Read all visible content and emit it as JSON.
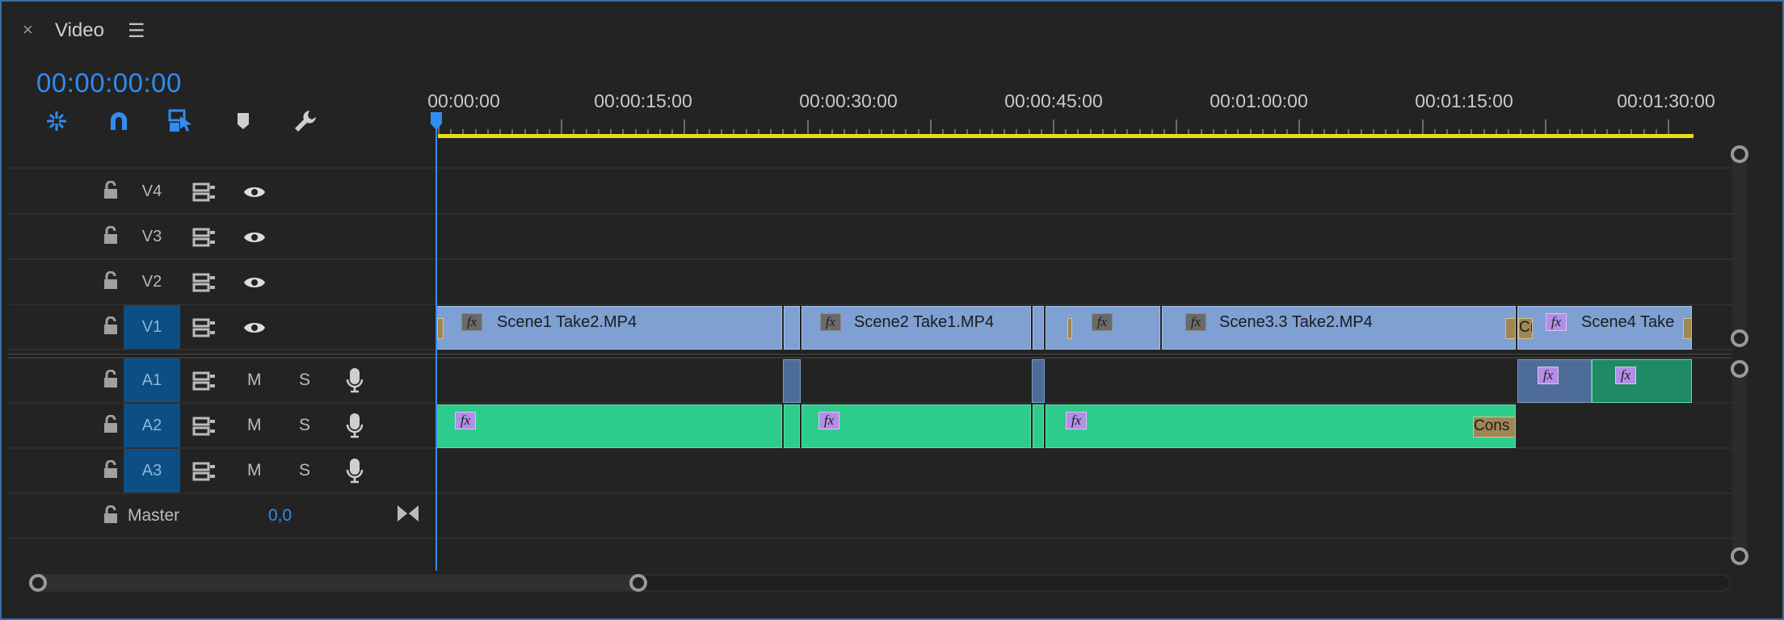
{
  "panel": {
    "close_glyph": "×",
    "title": "Video",
    "menu_glyph": "☰"
  },
  "timecode": "00:00:00:00",
  "toolbar": [
    "nest-sequence-icon",
    "snap-icon",
    "linked-selection-icon",
    "add-marker-icon",
    "timeline-settings-icon"
  ],
  "ruler": {
    "labels": [
      "00:00:00",
      "00:00:15:00",
      "00:00:30:00",
      "00:00:45:00",
      "00:01:00:00",
      "00:01:15:00",
      "00:01:30:00"
    ]
  },
  "tracks": {
    "video": [
      {
        "name": "V4",
        "targeted": false
      },
      {
        "name": "V3",
        "targeted": false
      },
      {
        "name": "V2",
        "targeted": false
      },
      {
        "name": "V1",
        "targeted": true
      }
    ],
    "audio": [
      {
        "name": "A1",
        "mute": "M",
        "solo": "S",
        "targeted": true
      },
      {
        "name": "A2",
        "mute": "M",
        "solo": "S",
        "targeted": true
      },
      {
        "name": "A3",
        "mute": "M",
        "solo": "S",
        "targeted": true
      }
    ],
    "master": {
      "label": "Master",
      "value": "0,0"
    }
  },
  "clips": {
    "v1": [
      {
        "label": "Scene1 Take2.MP4",
        "fx": "fx"
      },
      {
        "label": "Scene2 Take1.MP4",
        "fx": "fx"
      },
      {
        "label": "",
        "fx": "fx"
      },
      {
        "label": "Scene3.3 Take2.MP4",
        "fx": "fx"
      },
      {
        "label": "Scene4 Take",
        "fx": "fx"
      }
    ],
    "transitions": {
      "cross_short": "Cr",
      "constant": "Cons"
    },
    "audio_fx": "fx"
  },
  "colors": {
    "accent": "#2f8df0",
    "workbar": "#e8dc1a",
    "video_clip": "#7ea0d2",
    "audio_clip": "#2ecc8c",
    "fx_badge": "#b38ee6"
  }
}
